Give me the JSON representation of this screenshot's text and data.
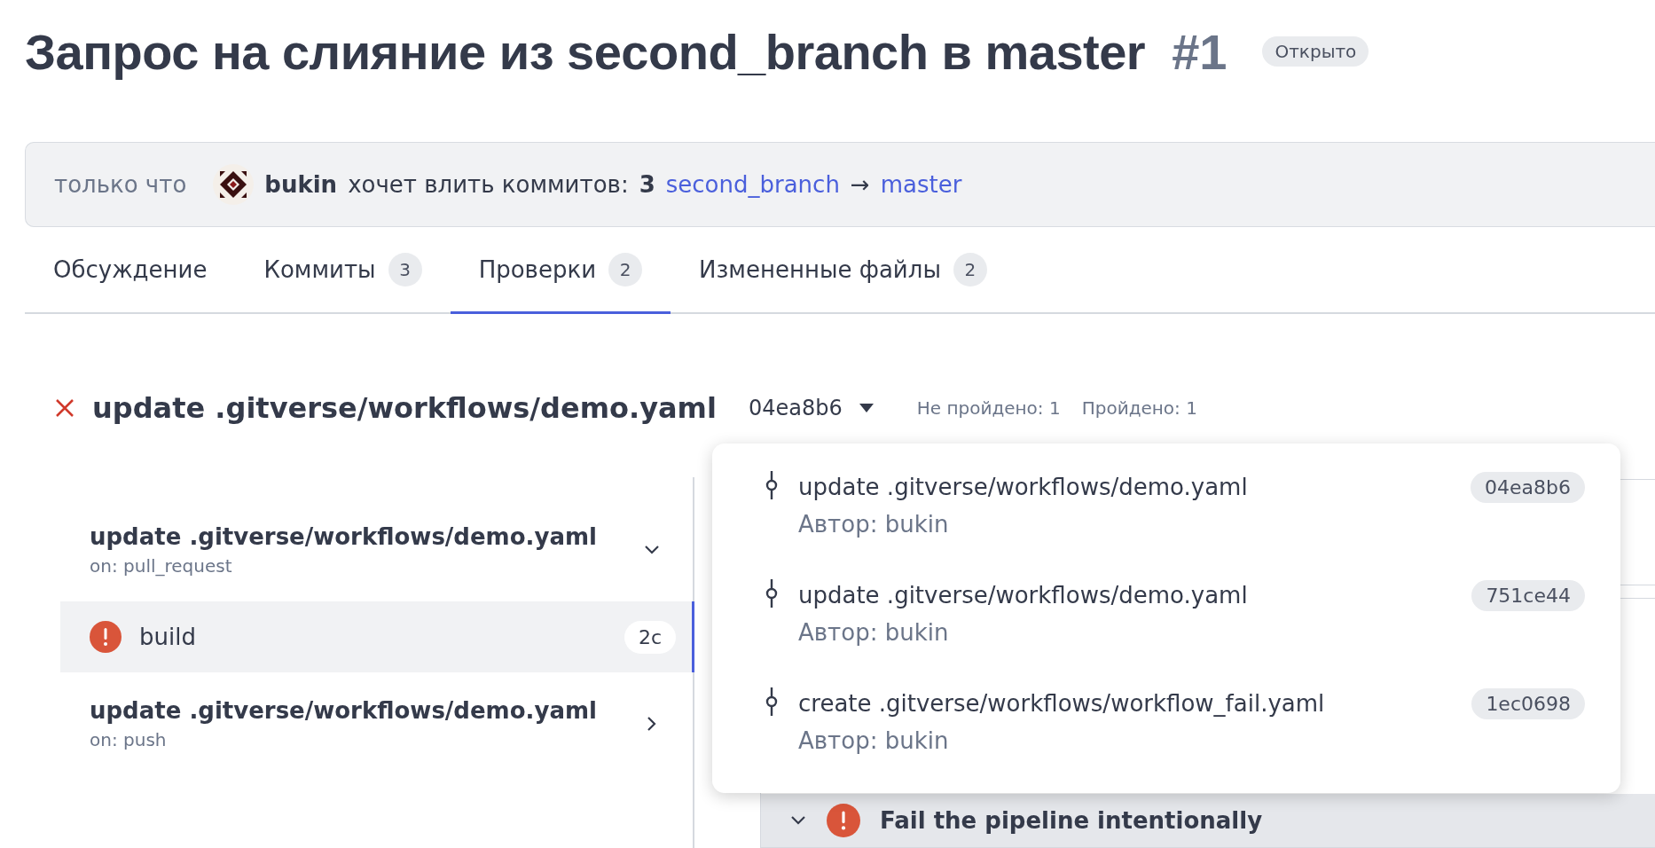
{
  "title": {
    "text": "Запрос на слияние из second_branch в master",
    "number": "#1",
    "status": "Открыто"
  },
  "summary": {
    "time": "только что",
    "author": "bukin",
    "action": "хочет влить коммитов:",
    "count": "3",
    "source_branch": "second_branch",
    "arrow": "→",
    "target_branch": "master"
  },
  "tabs": [
    {
      "label": "Обсуждение",
      "selected": false
    },
    {
      "label": "Коммиты",
      "count": "3",
      "selected": false
    },
    {
      "label": "Проверки",
      "count": "2",
      "selected": true
    },
    {
      "label": "Измененные файлы",
      "count": "2",
      "selected": false
    }
  ],
  "check": {
    "failed_state": true,
    "title": "update .gitverse/workflows/demo.yaml",
    "commit": "04ea8b6",
    "failed": "Не пройдено: 1",
    "passed": "Пройдено: 1"
  },
  "workflows": [
    {
      "title": "update .gitverse/workflows/demo.yaml",
      "trigger": "on: pull_request",
      "expanded": true,
      "jobs": [
        {
          "name": "build",
          "failed_state": true,
          "duration": "2с",
          "selected": true
        }
      ]
    },
    {
      "title": "update .gitverse/workflows/demo.yaml",
      "trigger": "on: push",
      "expanded": false
    }
  ],
  "steps": [
    {
      "name": "Fail the pipeline intentionally",
      "failed_state": true,
      "expanded": true
    }
  ],
  "commit_menu": [
    {
      "message": "update .gitverse/workflows/demo.yaml",
      "author": "Автор: bukin",
      "hash": "04ea8b6"
    },
    {
      "message": "update .gitverse/workflows/demo.yaml",
      "author": "Автор: bukin",
      "hash": "751ce44"
    },
    {
      "message": "create .gitverse/workflows/workflow_fail.yaml",
      "author": "Автор: bukin",
      "hash": "1ec0698"
    }
  ]
}
